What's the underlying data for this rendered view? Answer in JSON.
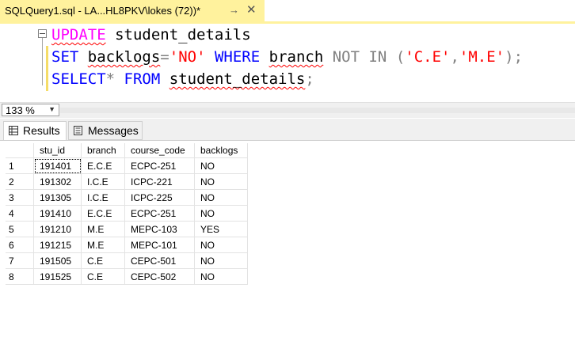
{
  "tab": {
    "title": "SQLQuery1.sql - LA...HL8PKV\\lokes (72))*",
    "pin_icon": "pin-icon",
    "close_icon": "close-icon"
  },
  "editor": {
    "line1": {
      "kw": "UPDATE",
      "rest": " student_details"
    },
    "line2": {
      "kw1": "SET",
      "sp1": " ",
      "col": "backlogs",
      "eq": "=",
      "val": "'NO'",
      "sp2": " ",
      "kw2": "WHERE",
      "sp3": " ",
      "col2": "branch",
      "sp4": " ",
      "kw3": "NOT IN",
      "sp5": " ",
      "lp": "(",
      "v1": "'C.E'",
      "comma": ",",
      "v2": "'M.E'",
      "rp": ");"
    },
    "line3": {
      "kw1": "SELECT",
      "star": "*",
      "sp1": " ",
      "kw2": "FROM",
      "sp2": " ",
      "tbl": "student_details",
      "semi": ";"
    }
  },
  "zoom": {
    "value": "133 %"
  },
  "result_tabs": [
    {
      "label": "Results"
    },
    {
      "label": "Messages"
    }
  ],
  "grid": {
    "columns": [
      "stu_id",
      "branch",
      "course_code",
      "backlogs"
    ],
    "rows": [
      {
        "num": "1",
        "stu_id": "191401",
        "branch": "E.C.E",
        "course_code": "ECPC-251",
        "backlogs": "NO"
      },
      {
        "num": "2",
        "stu_id": "191302",
        "branch": "I.C.E",
        "course_code": "ICPC-221",
        "backlogs": "NO"
      },
      {
        "num": "3",
        "stu_id": "191305",
        "branch": "I.C.E",
        "course_code": "ICPC-225",
        "backlogs": "NO"
      },
      {
        "num": "4",
        "stu_id": "191410",
        "branch": "E.C.E",
        "course_code": "ECPC-251",
        "backlogs": "NO"
      },
      {
        "num": "5",
        "stu_id": "191210",
        "branch": "M.E",
        "course_code": "MEPC-103",
        "backlogs": "YES"
      },
      {
        "num": "6",
        "stu_id": "191215",
        "branch": "M.E",
        "course_code": "MEPC-101",
        "backlogs": "NO"
      },
      {
        "num": "7",
        "stu_id": "191505",
        "branch": "C.E",
        "course_code": "CEPC-501",
        "backlogs": "NO"
      },
      {
        "num": "8",
        "stu_id": "191525",
        "branch": "C.E",
        "course_code": "CEPC-502",
        "backlogs": "NO"
      }
    ]
  }
}
